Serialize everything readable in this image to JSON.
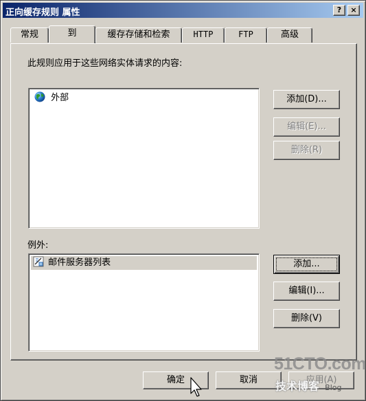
{
  "window": {
    "title": "正向缓存规则 属性",
    "help_button": "?",
    "close_button": "×"
  },
  "tabs": [
    {
      "label": "常规"
    },
    {
      "label": "到"
    },
    {
      "label": "缓存存储和检索"
    },
    {
      "label": "HTTP"
    },
    {
      "label": "FTP"
    },
    {
      "label": "高级"
    }
  ],
  "active_tab": "到",
  "applies_to": {
    "label": "此规则应用于这些网络实体请求的内容:",
    "items": [
      {
        "text": "外部",
        "icon": "globe-icon"
      }
    ],
    "add_label": "添加(D)...",
    "edit_label": "编辑(E)...",
    "delete_label": "删除(R)"
  },
  "exceptions": {
    "label": "例外:",
    "items": [
      {
        "text": "邮件服务器列表",
        "icon": "server-list-icon"
      }
    ],
    "add_label": "添加...",
    "edit_label": "编辑(I)...",
    "delete_label": "删除(V)"
  },
  "footer": {
    "ok_label": "确定",
    "cancel_label": "取消",
    "apply_label": "应用(A)"
  },
  "watermark": {
    "line1": "51CTO.com",
    "line2": "技术博客",
    "line3": "Blog"
  },
  "colors": {
    "titlebar_start": "#0a246a",
    "titlebar_end": "#a6caf0",
    "face": "#d4d0c8"
  }
}
